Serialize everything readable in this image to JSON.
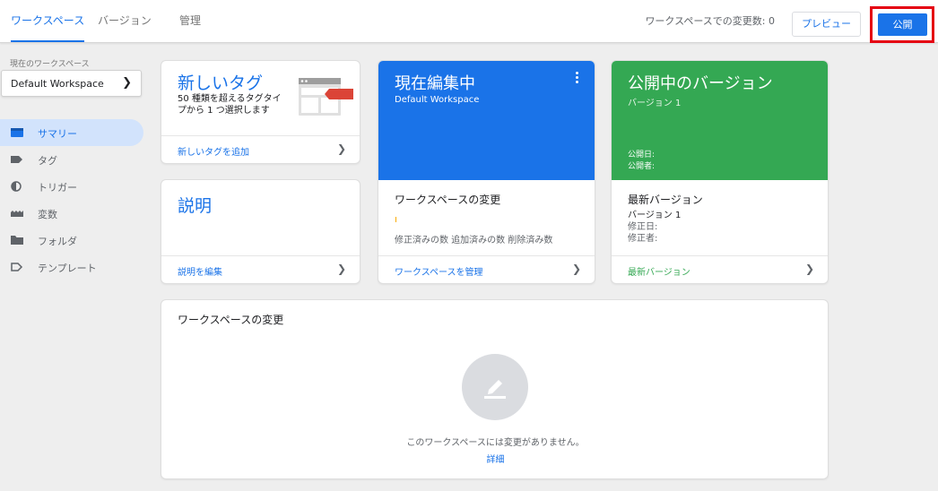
{
  "tabs": [
    {
      "label": "ワークスペース"
    },
    {
      "label": "バージョン"
    },
    {
      "label": "管理"
    }
  ],
  "header": {
    "changes_text": "ワークスペースでの変更数: 0",
    "preview_label": "プレビュー",
    "publish_label": "公開"
  },
  "sidebar": {
    "workspace_label": "現在のワークスペース",
    "workspace_name": "Default Workspace",
    "items": [
      {
        "label": "サマリー"
      },
      {
        "label": "タグ"
      },
      {
        "label": "トリガー"
      },
      {
        "label": "変数"
      },
      {
        "label": "フォルダ"
      },
      {
        "label": "テンプレート"
      }
    ]
  },
  "new_tag": {
    "title": "新しいタグ",
    "desc": "50 種類を超えるタグタイプから 1 つ選択します",
    "footer": "新しいタグを追加"
  },
  "description": {
    "title": "説明",
    "footer": "説明を編集"
  },
  "editing": {
    "title": "現在編集中",
    "workspace": "Default Workspace",
    "changes_title": "ワークスペースの変更",
    "changes_labels": "修正済みの数 追加済みの数 削除済み数",
    "footer": "ワークスペースを管理"
  },
  "published": {
    "title": "公開中のバージョン",
    "version": "バージョン 1",
    "published_date": "公開日:",
    "publisher": "公開者:",
    "latest_title": "最新バージョン",
    "latest_version": "バージョン 1",
    "modified_date": "修正日:",
    "modifier": "修正者:",
    "footer": "最新バージョン"
  },
  "ws_changes": {
    "title": "ワークスペースの変更",
    "empty_text": "このワークスペースには変更がありません。",
    "details_link": "詳細"
  },
  "colors": {
    "accent": "#1a73e8",
    "editing_bg": "#1a73e8",
    "published_bg": "#34a853",
    "publish_highlight": "#e50012"
  },
  "icons": [
    "summary-icon",
    "tag-icon",
    "trigger-icon",
    "variable-icon",
    "folder-icon",
    "template-icon",
    "edit-pencil-icon",
    "kebab-menu-icon",
    "chevron-right-icon"
  ]
}
